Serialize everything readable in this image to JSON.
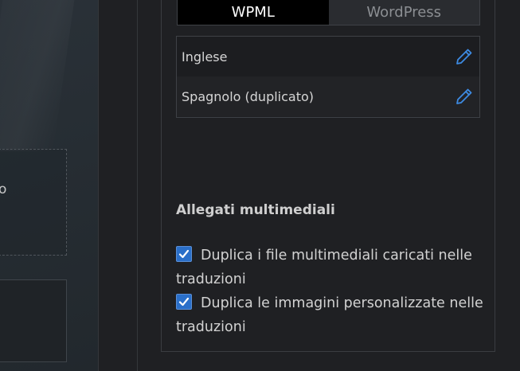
{
  "toggle": {
    "active_label": "WPML",
    "inactive_label": "WordPress"
  },
  "languages": [
    {
      "name": "Inglese"
    },
    {
      "name": "Spagnolo (duplicato)"
    }
  ],
  "left_canvas": {
    "partial_text": "o"
  },
  "media": {
    "title": "Allegati multimediali",
    "options": [
      {
        "label": "Duplica i file multimediali caricati nelle traduzioni",
        "checked": true
      },
      {
        "label": "Duplica le immagini personalizzate nelle traduzioni",
        "checked": true
      }
    ]
  },
  "colors": {
    "accent": "#2a6fc9",
    "pencil": "#3d8be3",
    "background": "#1f2023"
  },
  "icons": {
    "edit": "pencil-icon",
    "check": "checkmark-icon"
  }
}
